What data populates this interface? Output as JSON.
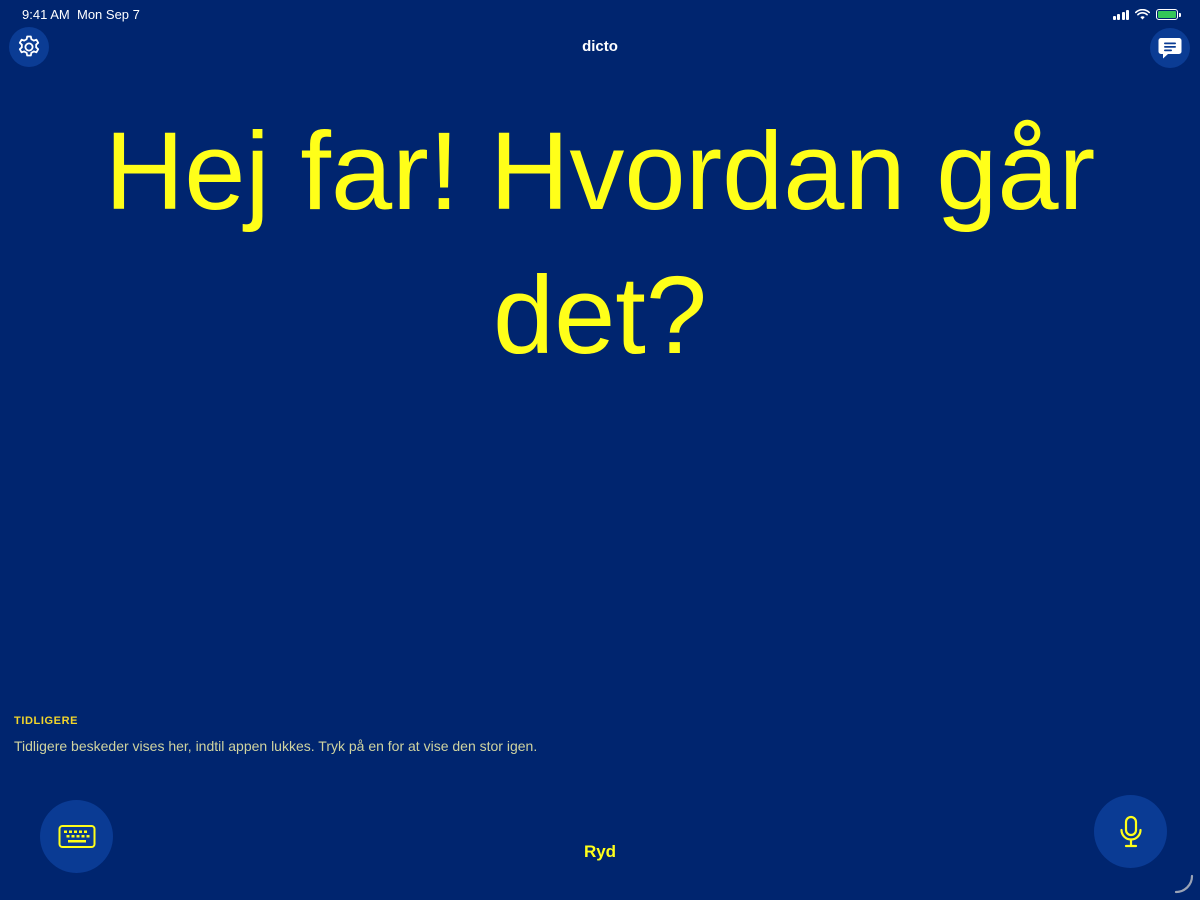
{
  "status_bar": {
    "time": "9:41 AM",
    "date": "Mon Sep 7"
  },
  "header": {
    "title": "dicto",
    "settings_icon": "gear-icon",
    "chat_icon": "chat-bubble-icon"
  },
  "main": {
    "message": "Hej far! Hvordan går det?"
  },
  "history": {
    "title": "TIDLIGERE",
    "description": "Tidligere beskeder vises her, indtil appen lukkes. Tryk på en for at vise den stor igen."
  },
  "footer": {
    "keyboard_icon": "keyboard-icon",
    "clear_label": "Ryd",
    "mic_icon": "microphone-icon"
  },
  "colors": {
    "background": "#00256f",
    "accent_yellow": "#ffff19",
    "button_bg": "#0a3b94",
    "battery_green": "#34c759"
  }
}
